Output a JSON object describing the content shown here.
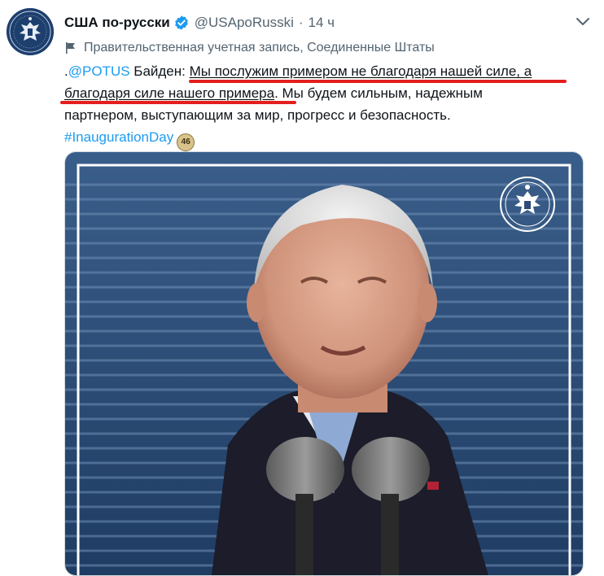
{
  "account": {
    "display_name": "США по-русски",
    "handle": "@USApoRusski",
    "separator": "·",
    "time": "14 ч",
    "government_label": "Правительственная учетная запись, Соединенные Штаты"
  },
  "tweet": {
    "prefix": ".",
    "mention": "@POTUS",
    "speaker": " Байден: ",
    "quote_part1": "Мы послужим примером не благодаря нашей силе, а",
    "quote_part2": "благодаря силе нашего примера",
    "rest_part1": ". Мы будем сильным, надежным",
    "rest_part2": "партнером, выступающим за мир, прогресс и безопасность.",
    "hashtag": "#InaugurationDay",
    "hashtag_emoji": "46"
  },
  "colors": {
    "link": "#1d9bf0",
    "secondary_text": "#536471",
    "highlight_line": "#e41e1e",
    "seal_blue": "#1d3f6e"
  },
  "icons": {
    "verified": "verified-badge-icon",
    "more": "chevron-down-icon",
    "government": "flag-icon"
  }
}
